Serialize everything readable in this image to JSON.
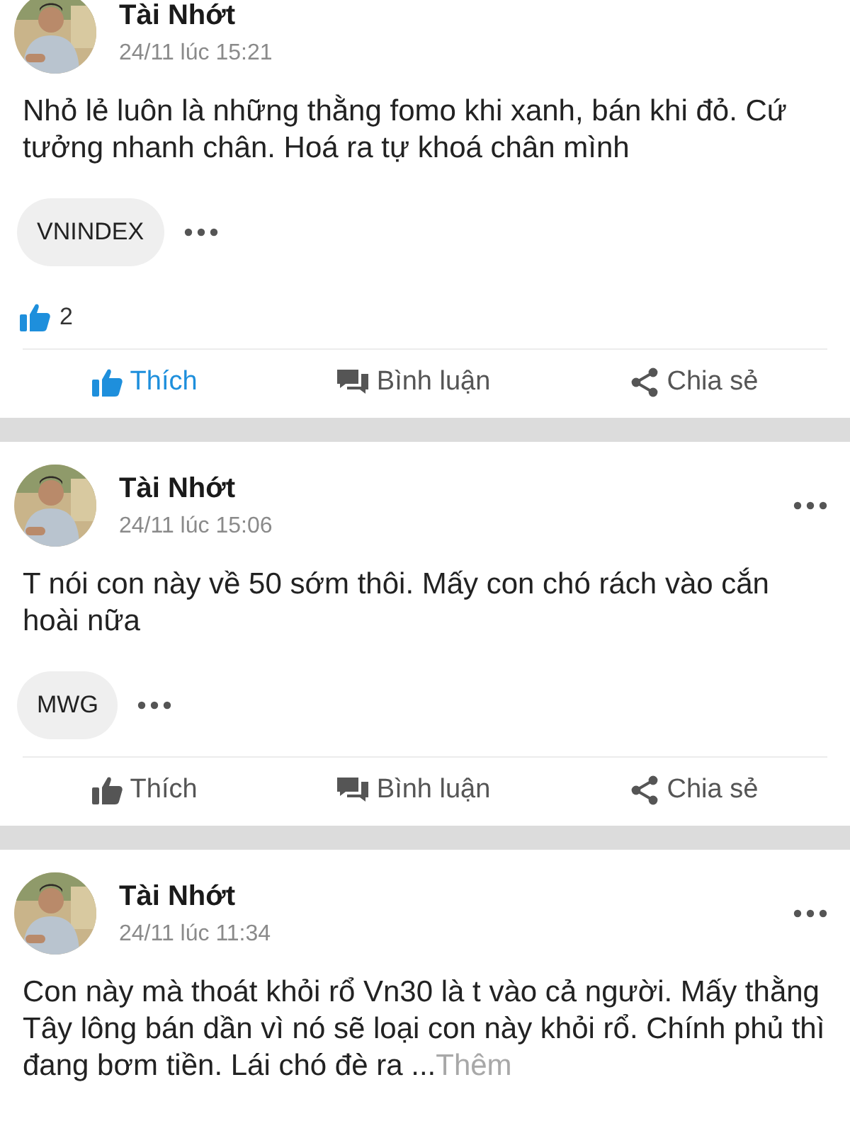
{
  "posts": [
    {
      "author": "Tài Nhớt",
      "time": "24/11 lúc 15:21",
      "menu": false,
      "text": "Nhỏ lẻ luôn là những thằng fomo khi xanh, bán khi đỏ. Cứ tưởng nhanh chân. Hoá ra tự khoá chân mình",
      "tags": [
        "VNINDEX"
      ],
      "likes": "2",
      "actions": [
        {
          "kind": "like",
          "label": "Thích",
          "selected": true
        },
        {
          "kind": "comment",
          "label": "Bình luận",
          "selected": false
        },
        {
          "kind": "share",
          "label": "Chia sẻ",
          "selected": false
        }
      ]
    },
    {
      "author": "Tài Nhớt",
      "time": "24/11 lúc 15:06",
      "menu": true,
      "text": "T nói con này về 50 sớm thôi. Mấy con chó rách vào cắn hoài nữa",
      "tags": [
        "MWG"
      ],
      "actions": [
        {
          "kind": "like",
          "label": "Thích",
          "selected": false
        },
        {
          "kind": "comment",
          "label": "Bình luận",
          "selected": false
        },
        {
          "kind": "share",
          "label": "Chia sẻ",
          "selected": false
        }
      ]
    },
    {
      "author": "Tài Nhớt",
      "time": "24/11 lúc 11:34",
      "menu": true,
      "text": "Con này mà thoát khỏi rổ Vn30 là t vào cả người. Mấy thằng Tây lông bán dần vì nó sẽ loại con này khỏi rổ. Chính phủ thì đang bơm tiền. Lái chó đè ra ...",
      "more": "Thêm"
    }
  ]
}
